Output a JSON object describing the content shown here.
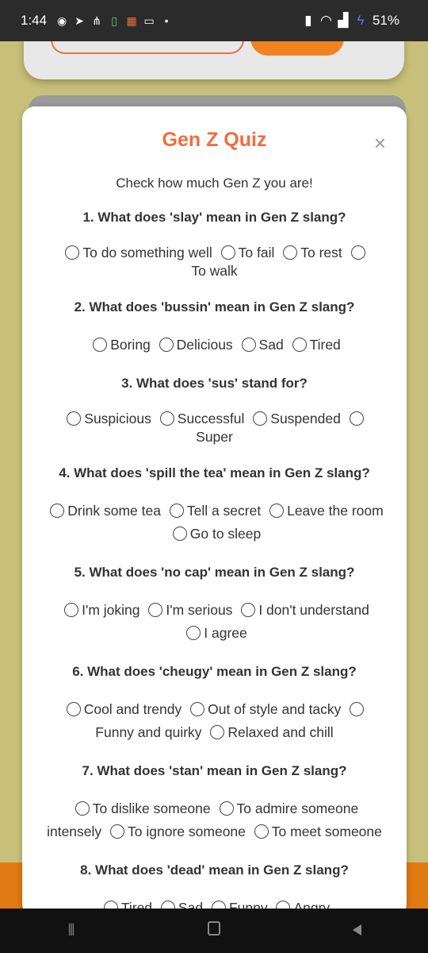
{
  "status_bar": {
    "time": "1:44",
    "battery": "51%",
    "notification_icons": [
      "messenger-icon",
      "telegram-icon",
      "network-icon",
      "battery-saver-icon",
      "pattern-app-icon",
      "book-icon",
      "dot-icon"
    ],
    "status_icons": [
      "vibrate-icon",
      "wifi-icon",
      "signal-icon",
      "charging-bolt-icon"
    ]
  },
  "modal": {
    "title": "Gen Z Quiz",
    "close_label": "×",
    "subtitle": "Check how much Gen Z you are!"
  },
  "questions": [
    {
      "text": "1. What does 'slay' mean in Gen Z slang?",
      "options": [
        "To do something well",
        "To fail",
        "To rest",
        "To walk"
      ]
    },
    {
      "text": "2. What does 'bussin' mean in Gen Z slang?",
      "options": [
        "Boring",
        "Delicious",
        "Sad",
        "Tired"
      ]
    },
    {
      "text": "3. What does 'sus' stand for?",
      "options": [
        "Suspicious",
        "Successful",
        "Suspended",
        "Super"
      ]
    },
    {
      "text": "4. What does 'spill the tea' mean in Gen Z slang?",
      "options": [
        "Drink some tea",
        "Tell a secret",
        "Leave the room",
        "Go to sleep"
      ]
    },
    {
      "text": "5. What does 'no cap' mean in Gen Z slang?",
      "options": [
        "I'm joking",
        "I'm serious",
        "I don't understand",
        "I agree"
      ]
    },
    {
      "text": "6. What does 'cheugy' mean in Gen Z slang?",
      "options": [
        "Cool and trendy",
        "Out of style and tacky",
        "Funny and quirky",
        "Relaxed and chill"
      ]
    },
    {
      "text": "7. What does 'stan' mean in Gen Z slang?",
      "options": [
        "To dislike someone",
        "To admire someone intensely",
        "To ignore someone",
        "To meet someone"
      ]
    },
    {
      "text": "8. What does 'dead' mean in Gen Z slang?",
      "options": [
        "Tired",
        "Sad",
        "Funny",
        "Angry"
      ]
    }
  ],
  "colors": {
    "accent": "#f06d3d",
    "background": "#c8c07a",
    "bottom_orange": "#e07a12"
  }
}
